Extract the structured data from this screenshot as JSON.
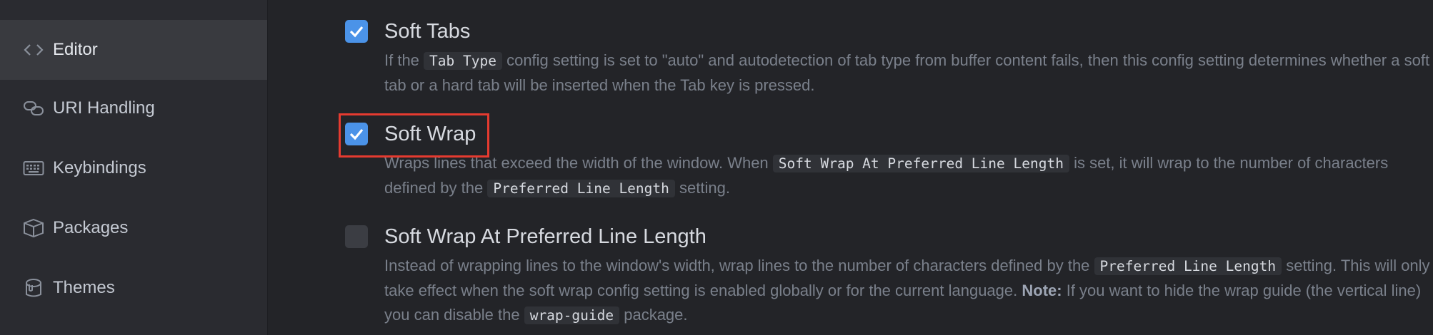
{
  "sidebar": {
    "items": [
      {
        "label": "Editor",
        "icon": "code-icon",
        "active": true
      },
      {
        "label": "URI Handling",
        "icon": "link-icon",
        "active": false
      },
      {
        "label": "Keybindings",
        "icon": "keyboard-icon",
        "active": false
      },
      {
        "label": "Packages",
        "icon": "package-icon",
        "active": false
      },
      {
        "label": "Themes",
        "icon": "paint-bucket-icon",
        "active": false
      }
    ]
  },
  "settings": {
    "soft_tabs": {
      "title": "Soft Tabs",
      "checked": true,
      "desc": {
        "t1": "If the ",
        "c1": "Tab Type",
        "t2": " config setting is set to \"auto\" and autodetection of tab type from buffer content fails, then this config setting determines whether a soft tab or a hard tab will be inserted when the Tab key is pressed."
      }
    },
    "soft_wrap": {
      "title": "Soft Wrap",
      "checked": true,
      "desc": {
        "t1": "Wraps lines that exceed the width of the window. When ",
        "c1": "Soft Wrap At Preferred Line Length",
        "t2": " is set, it will wrap to the number of characters defined by the ",
        "c2": "Preferred Line Length",
        "t3": " setting."
      }
    },
    "soft_wrap_preferred": {
      "title": "Soft Wrap At Preferred Line Length",
      "checked": false,
      "desc": {
        "t1": "Instead of wrapping lines to the window's width, wrap lines to the number of characters defined by the ",
        "c1": "Preferred Line Length",
        "t2": " setting. This will only take effect when the soft wrap config setting is enabled globally or for the current language. ",
        "note": "Note:",
        "t3": " If you want to hide the wrap guide (the vertical line) you can disable the ",
        "c2": "wrap-guide",
        "t4": " package."
      }
    }
  },
  "colors": {
    "accent": "#4b93e8",
    "highlight": "#e53b30",
    "background": "#232428",
    "sidebar": "#2a2b30"
  }
}
